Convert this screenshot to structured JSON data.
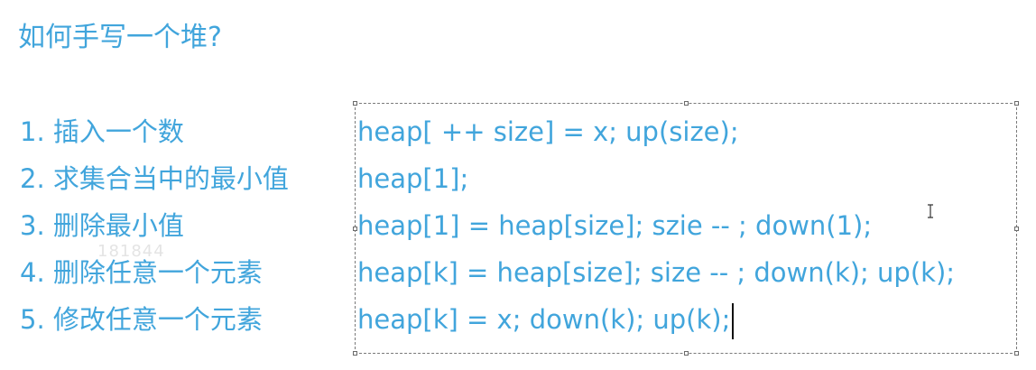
{
  "slide": {
    "title": "如何手写一个堆?",
    "items": [
      "1. 插入一个数",
      "2. 求集合当中的最小值",
      "3. 删除最小值",
      "4. 删除任意一个元素",
      "5. 修改任意一个元素"
    ],
    "code_lines": [
      "heap[ ++ size] = x; up(size);",
      "heap[1];",
      "heap[1] = heap[size]; szie -- ; down(1);",
      "heap[k] = heap[size]; size -- ; down(k); up(k);",
      "heap[k] = x; down(k); up(k);"
    ],
    "watermark": "181844"
  },
  "cursor": {
    "icon": "text-cursor-icon"
  },
  "colors": {
    "text": "#41a5dc",
    "selection_border": "#7a7a7a"
  }
}
